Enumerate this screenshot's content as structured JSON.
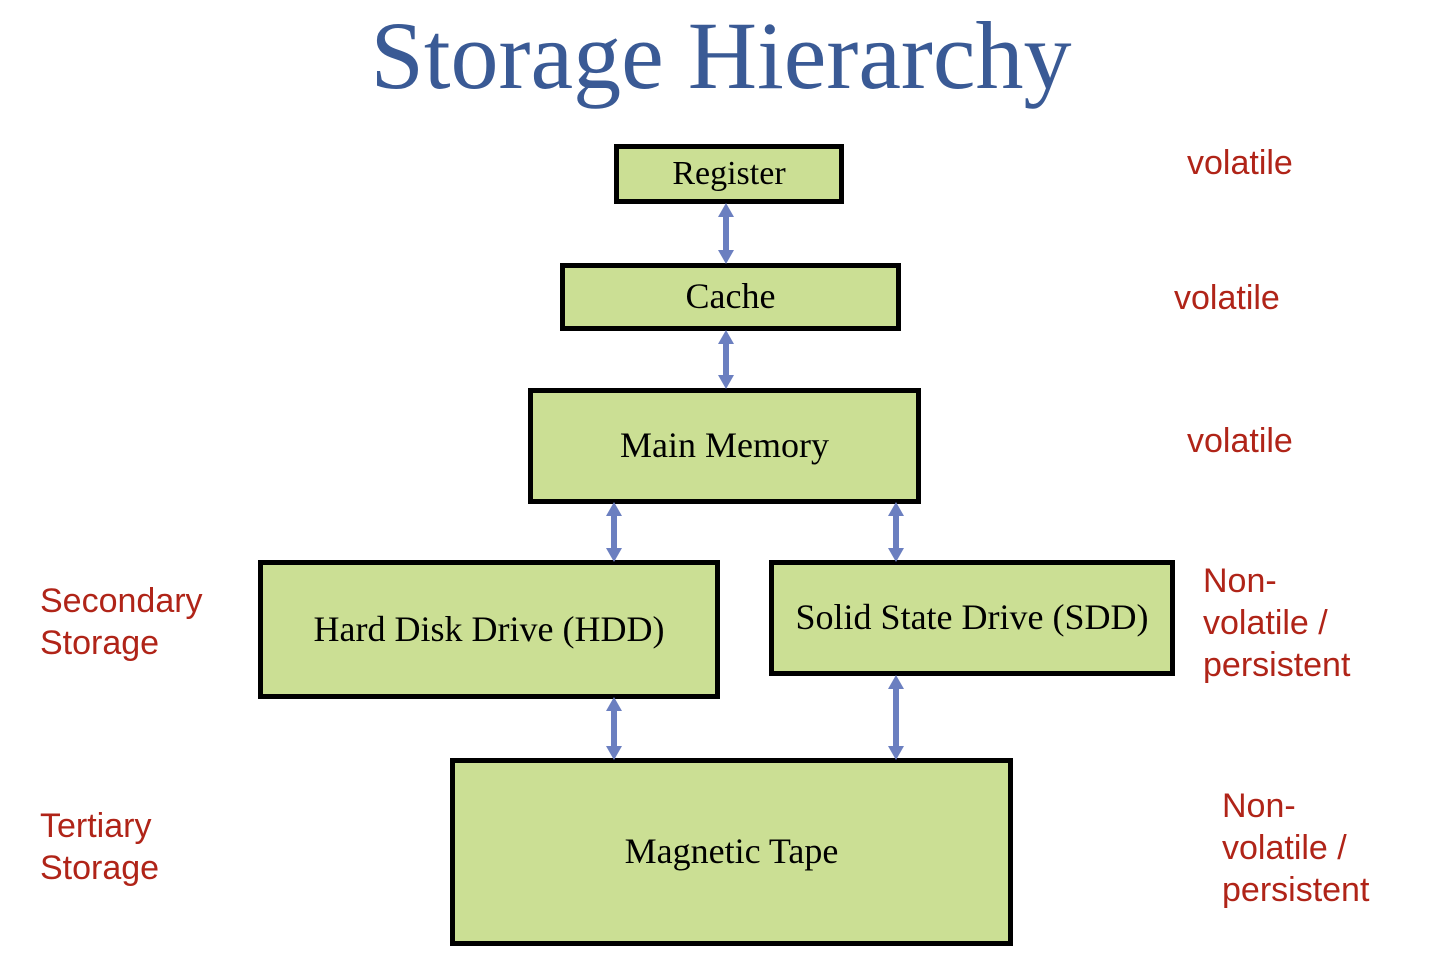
{
  "slide": {
    "title": "Storage Hierarchy",
    "title_color": "#3a5a95",
    "background_color": "#ffffff"
  },
  "theme": {
    "box_fill": "#cbdf94",
    "box_border": "#000000",
    "arrow_color": "#6b7fc0",
    "annotation_color": "#b02418"
  },
  "nodes": [
    {
      "id": "register",
      "label": "Register"
    },
    {
      "id": "cache",
      "label": "Cache"
    },
    {
      "id": "main_memory",
      "label": "Main Memory"
    },
    {
      "id": "hdd",
      "label": "Hard Disk Drive (HDD)"
    },
    {
      "id": "ssd",
      "label": "Solid State Drive (SDD)"
    },
    {
      "id": "tape",
      "label": "Magnetic Tape"
    }
  ],
  "connections": [
    {
      "id": "register-cache",
      "from": "register",
      "to": "cache",
      "style": "double-arrow"
    },
    {
      "id": "cache-main_memory",
      "from": "cache",
      "to": "main_memory",
      "style": "double-arrow"
    },
    {
      "id": "main_memory-hdd",
      "from": "main_memory",
      "to": "hdd",
      "style": "double-arrow"
    },
    {
      "id": "main_memory-ssd",
      "from": "main_memory",
      "to": "ssd",
      "style": "double-arrow"
    },
    {
      "id": "hdd-tape",
      "from": "hdd",
      "to": "tape",
      "style": "double-arrow"
    },
    {
      "id": "ssd-tape",
      "from": "ssd",
      "to": "tape",
      "style": "double-arrow"
    }
  ],
  "annotations": {
    "right": [
      {
        "id": "volatile-register",
        "target": "register",
        "text": "volatile"
      },
      {
        "id": "volatile-cache",
        "target": "cache",
        "text": "volatile"
      },
      {
        "id": "volatile-main-memory",
        "target": "main_memory",
        "text": "volatile"
      },
      {
        "id": "nonvolatile-ssd",
        "target": "ssd",
        "text": "Non-\nvolatile /\npersistent"
      },
      {
        "id": "nonvolatile-tape",
        "target": "tape",
        "text": "Non-\nvolatile /\npersistent"
      }
    ],
    "left": [
      {
        "id": "secondary-storage",
        "target": "hdd",
        "text": "Secondary\nStorage"
      },
      {
        "id": "tertiary-storage",
        "target": "tape",
        "text": "Tertiary\nStorage"
      }
    ]
  }
}
